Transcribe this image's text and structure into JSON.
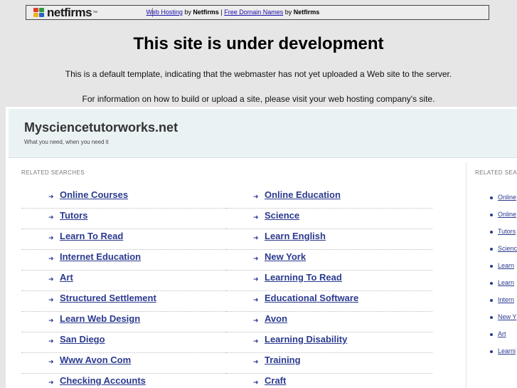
{
  "banner": {
    "logo_text": "netfirms",
    "logo_tm": "™",
    "logo_colors": [
      "#e53a2d",
      "#2f9a3c",
      "#f2b21c",
      "#2a64c9"
    ],
    "link1": "Web Hosting",
    "by1": " by ",
    "brand1": "Netfirms",
    "sep": " | ",
    "link2": "Free Domain Names",
    "by2": " by ",
    "brand2": "Netfirms"
  },
  "headline": "This site is under development",
  "notice1": "This is a default template, indicating that the webmaster has not yet uploaded a Web site to the server.",
  "notice2": "For information on how to build or upload a site, please visit your web hosting company's site.",
  "site": {
    "name": "Mysciencetutorworks.net",
    "tagline": "What you need, when you need it",
    "header_right": "‹"
  },
  "related_title": "RELATED SEARCHES",
  "related_title_right": "RELATED SEA",
  "left_column": [
    "Online Courses",
    "Tutors",
    "Learn To Read",
    "Internet Education",
    "Art",
    "Structured Settlement",
    "Learn Web Design",
    "San Diego",
    "Www Avon Com",
    "Checking Accounts"
  ],
  "right_column": [
    "Online Education",
    "Science",
    "Learn English",
    "New York",
    "Learning To Read",
    "Educational Software",
    "Avon",
    "Learning Disability",
    "Training",
    "Craft"
  ],
  "side_list": [
    "Online",
    "Online",
    "Tutors",
    "Scienc",
    "Learn",
    "Learn",
    "Intern",
    "New Y",
    "Art",
    "Learni"
  ],
  "colors": {
    "link": "#2b3a8f",
    "header_bg": "#eaf2f4",
    "page_bg": "#e6e6e6"
  }
}
